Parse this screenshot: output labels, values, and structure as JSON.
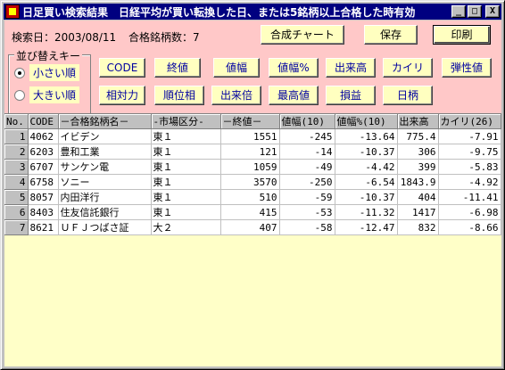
{
  "window": {
    "title": "日足買い検索結果　日経平均が買い転換した日、または5銘柄以上合格した時有効",
    "minimize": "_",
    "maximize": "□",
    "close": "X"
  },
  "info": {
    "search_date": "検索日：2003/08/11",
    "pass_count": "合格銘柄数：7"
  },
  "actions": {
    "chart": "合成チャート",
    "save": "保存",
    "print": "印刷"
  },
  "sort": {
    "label": "並び替えキー",
    "ascending": "小さい順",
    "descending": "大きい順",
    "keys_row1": [
      "CODE",
      "終値",
      "値幅",
      "値幅%",
      "出来高",
      "カイリ",
      "弾性値"
    ],
    "keys_row2": [
      "相対力",
      "順位相",
      "出来倍",
      "最高値",
      "損益",
      "日柄"
    ]
  },
  "table": {
    "columns": [
      "No.",
      "CODE",
      "－合格銘柄名－",
      "-市場区分-",
      "－終値－",
      "値幅(10)",
      "値幅%(10)",
      "出来高",
      "カイリ(26)"
    ],
    "rows": [
      [
        "1",
        "4062",
        "イビデン",
        "東１",
        "1551",
        "-245",
        "-13.64",
        "775.4",
        "-7.91"
      ],
      [
        "2",
        "6203",
        "豊和工業",
        "東１",
        "121",
        "-14",
        "-10.37",
        "306",
        "-9.75"
      ],
      [
        "3",
        "6707",
        "サンケン電",
        "東１",
        "1059",
        "-49",
        "-4.42",
        "399",
        "-5.83"
      ],
      [
        "4",
        "6758",
        "ソニー",
        "東１",
        "3570",
        "-250",
        "-6.54",
        "1843.9",
        "-4.92"
      ],
      [
        "5",
        "8057",
        "内田洋行",
        "東１",
        "510",
        "-59",
        "-10.37",
        "404",
        "-11.41"
      ],
      [
        "6",
        "8403",
        "住友信託銀行",
        "東１",
        "415",
        "-53",
        "-11.32",
        "1417",
        "-6.98"
      ],
      [
        "7",
        "8621",
        "ＵＦＪつばさ証",
        "大２",
        "407",
        "-58",
        "-12.47",
        "832",
        "-8.66"
      ]
    ]
  }
}
